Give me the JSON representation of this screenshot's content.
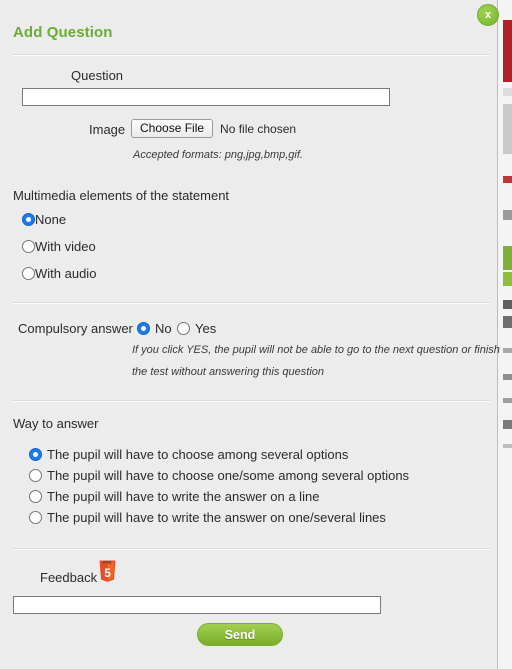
{
  "modal": {
    "title": "Add Question",
    "close_label": "x",
    "close_icon": "close-icon"
  },
  "question": {
    "label": "Question",
    "value": "",
    "placeholder": ""
  },
  "image": {
    "label": "Image",
    "choose_file_label": "Choose File",
    "file_status": "No file chosen",
    "accepted_formats": "Accepted formats: png,jpg,bmp,gif."
  },
  "multimedia": {
    "title": "Multimedia elements of the statement",
    "options": [
      {
        "label": "None",
        "checked": true
      },
      {
        "label": "With video",
        "checked": false
      },
      {
        "label": "With audio",
        "checked": false
      }
    ]
  },
  "compulsory": {
    "label": "Compulsory answer",
    "options": [
      {
        "label": "No",
        "checked": true
      },
      {
        "label": "Yes",
        "checked": false
      }
    ],
    "hint_line1": "If you click YES, the pupil will not be able to go to the next question or finish",
    "hint_line2": "the test without answering this question"
  },
  "way_to_answer": {
    "title": "Way to answer",
    "options": [
      {
        "label": "The pupil will have to choose among several options",
        "checked": true
      },
      {
        "label": "The pupil will have to choose one/some among several options",
        "checked": false
      },
      {
        "label": "The pupil will have to write the answer on a line",
        "checked": false
      },
      {
        "label": "The pupil will have to write the answer on one/several lines",
        "checked": false
      }
    ]
  },
  "feedback": {
    "label": "Feedback",
    "editor_icon": "html5-icon",
    "html5_badge_text": "HTML",
    "html5_badge_number": "5",
    "value": "",
    "placeholder": ""
  },
  "submit": {
    "label": "Send"
  },
  "colors": {
    "title_green": "#6aac34",
    "button_green": "#8dbe3c",
    "radio_blue": "#1a7bed",
    "modal_bg": "#ececec",
    "html5_orange": "#e44d26"
  }
}
